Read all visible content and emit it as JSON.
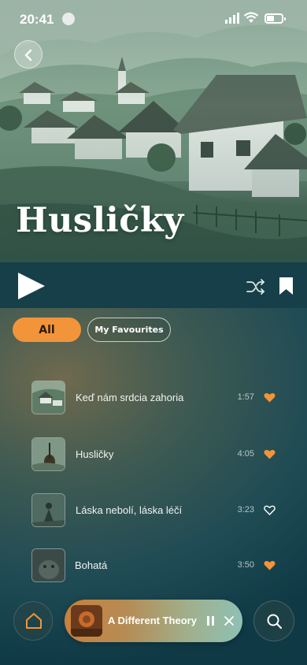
{
  "status_bar": {
    "time": "20:41"
  },
  "playlist": {
    "title": "Husličky"
  },
  "filters": {
    "all_label": "All",
    "favourites_label": "My Favourites",
    "active": "All"
  },
  "tracks": [
    {
      "title": "Keď nám srdcia zahoria",
      "duration": "1:57",
      "favourite": true
    },
    {
      "title": "Husličky",
      "duration": "4:05",
      "favourite": true
    },
    {
      "title": "Láska nebolí, láska léčí",
      "duration": "3:23",
      "favourite": false
    },
    {
      "title": "Bohatá",
      "duration": "3:50",
      "favourite": true
    }
  ],
  "now_playing": {
    "title": "A Different Theory"
  },
  "colors": {
    "accent": "#f2943a",
    "background": "#0f3a45",
    "heart_filled": "#f2943a"
  },
  "icons": [
    "back-icon",
    "play-icon",
    "shuffle-icon",
    "bookmark-icon",
    "heart-icon",
    "home-icon",
    "pause-icon",
    "close-icon",
    "search-icon"
  ]
}
